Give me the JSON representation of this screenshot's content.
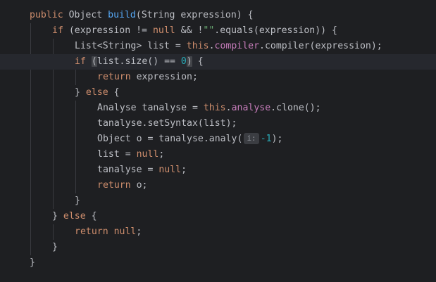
{
  "editor": {
    "theme_colors": {
      "background": "#1e1f22",
      "current_line": "#26282e",
      "keyword": "#cf8e6d",
      "function": "#56a8f5",
      "field": "#c77dbb",
      "string": "#6aab73",
      "number": "#2aacb8",
      "text": "#bcbec4",
      "indent_guide": "#393b40"
    },
    "current_line_index": 3,
    "lines": [
      {
        "tokens": [
          {
            "text": "public",
            "type": "kw"
          },
          {
            "text": " Object ",
            "type": "txt"
          },
          {
            "text": "build",
            "type": "fn"
          },
          {
            "text": "(String expression) {",
            "type": "txt"
          }
        ]
      },
      {
        "tokens": [
          {
            "text": "if",
            "type": "kw"
          },
          {
            "text": " (expression != ",
            "type": "txt"
          },
          {
            "text": "null",
            "type": "kw"
          },
          {
            "text": " && !",
            "type": "txt"
          },
          {
            "text": "\"\"",
            "type": "str"
          },
          {
            "text": ".equals(expression)) {",
            "type": "txt"
          }
        ]
      },
      {
        "tokens": [
          {
            "text": "List<String> list = ",
            "type": "txt"
          },
          {
            "text": "this",
            "type": "kw"
          },
          {
            "text": ".",
            "type": "txt"
          },
          {
            "text": "compiler",
            "type": "fld"
          },
          {
            "text": ".compiler(expression);",
            "type": "txt"
          }
        ]
      },
      {
        "tokens": [
          {
            "text": "if",
            "type": "kw"
          },
          {
            "text": " ",
            "type": "txt"
          },
          {
            "text": "(",
            "type": "txt",
            "match": true
          },
          {
            "text": "list.size() == ",
            "type": "txt"
          },
          {
            "text": "0",
            "type": "num"
          },
          {
            "text": ")",
            "type": "txt",
            "match": true
          },
          {
            "text": " {",
            "type": "txt"
          }
        ]
      },
      {
        "tokens": [
          {
            "text": "return",
            "type": "kw"
          },
          {
            "text": " expression;",
            "type": "txt"
          }
        ]
      },
      {
        "tokens": [
          {
            "text": "} ",
            "type": "txt"
          },
          {
            "text": "else",
            "type": "kw"
          },
          {
            "text": " {",
            "type": "txt"
          }
        ]
      },
      {
        "tokens": [
          {
            "text": "Analyse tanalyse = ",
            "type": "txt"
          },
          {
            "text": "this",
            "type": "kw"
          },
          {
            "text": ".",
            "type": "txt"
          },
          {
            "text": "analyse",
            "type": "fld"
          },
          {
            "text": ".clone();",
            "type": "txt"
          }
        ]
      },
      {
        "tokens": [
          {
            "text": "tanalyse.setSyntax(list);",
            "type": "txt"
          }
        ]
      },
      {
        "tokens": [
          {
            "text": "Object o = tanalyse.analy(",
            "type": "txt"
          },
          {
            "text": "i:",
            "type": "hint"
          },
          {
            "text": "-1",
            "type": "num"
          },
          {
            "text": ");",
            "type": "txt"
          }
        ]
      },
      {
        "tokens": [
          {
            "text": "list = ",
            "type": "txt"
          },
          {
            "text": "null",
            "type": "kw"
          },
          {
            "text": ";",
            "type": "txt"
          }
        ]
      },
      {
        "tokens": [
          {
            "text": "tanalyse = ",
            "type": "txt"
          },
          {
            "text": "null",
            "type": "kw"
          },
          {
            "text": ";",
            "type": "txt"
          }
        ]
      },
      {
        "tokens": [
          {
            "text": "return",
            "type": "kw"
          },
          {
            "text": " o;",
            "type": "txt"
          }
        ]
      },
      {
        "tokens": [
          {
            "text": "}",
            "type": "txt"
          }
        ]
      },
      {
        "tokens": [
          {
            "text": "} ",
            "type": "txt"
          },
          {
            "text": "else",
            "type": "kw"
          },
          {
            "text": " {",
            "type": "txt"
          }
        ]
      },
      {
        "tokens": [
          {
            "text": "return",
            "type": "kw"
          },
          {
            "text": " ",
            "type": "txt"
          },
          {
            "text": "null",
            "type": "kw"
          },
          {
            "text": ";",
            "type": "txt"
          }
        ]
      },
      {
        "tokens": [
          {
            "text": "}",
            "type": "txt"
          }
        ]
      },
      {
        "tokens": [
          {
            "text": "}",
            "type": "txt"
          }
        ]
      }
    ]
  }
}
